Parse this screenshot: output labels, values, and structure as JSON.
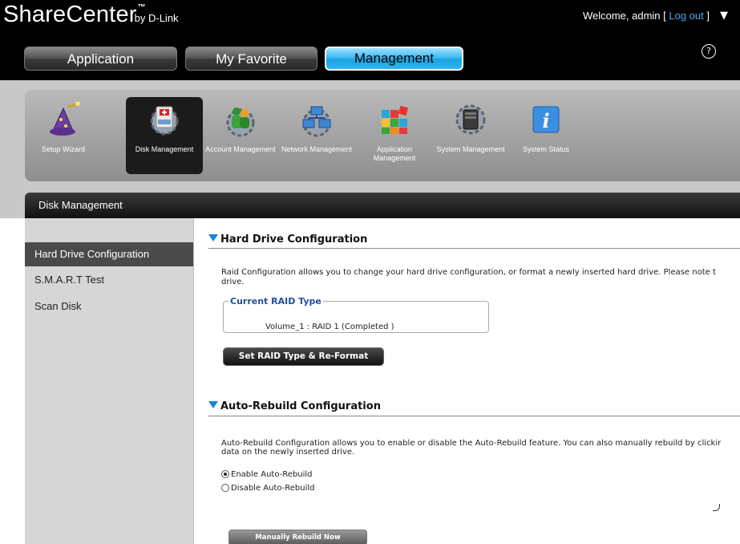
{
  "header": {
    "logo": {
      "name": "ShareCenter",
      "tm": "™",
      "by": "by D-Link"
    },
    "welcome_prefix": "Welcome, admin [ ",
    "logout": "Log out",
    "welcome_suffix": " ]",
    "caret": "▼",
    "help": "?"
  },
  "nav": {
    "tabs": [
      {
        "label": "Application"
      },
      {
        "label": "My Favorite"
      },
      {
        "label": "Management"
      }
    ],
    "active": "Management"
  },
  "toolbar": {
    "items": [
      {
        "label": "Setup Wizard",
        "icon": "wizard-icon"
      },
      {
        "label": "Disk Management",
        "icon": "disk-management-icon"
      },
      {
        "label": "Account Management",
        "icon": "account-management-icon"
      },
      {
        "label": "Network Management",
        "icon": "network-management-icon"
      },
      {
        "label": "Application Management",
        "icon": "application-management-icon"
      },
      {
        "label": "System Management",
        "icon": "system-management-icon"
      },
      {
        "label": "System Status",
        "icon": "system-status-icon"
      }
    ],
    "active": "Disk Management"
  },
  "section": {
    "title": "Disk Management"
  },
  "sidebar": {
    "items": [
      {
        "label": "Hard Drive Configuration"
      },
      {
        "label": "S.M.A.R.T Test"
      },
      {
        "label": "Scan Disk"
      }
    ],
    "active": "Hard Drive Configuration"
  },
  "hard_drive": {
    "title": "Hard Drive Configuration",
    "desc_line1": "Raid Configuration allows you to change your hard drive configuration, or format a newly inserted hard drive. Please note t",
    "desc_line2": "drive.",
    "raid_legend": "Current RAID Type",
    "raid_value": "Volume_1 : RAID 1 (Completed )",
    "set_button": "Set RAID Type & Re-Format"
  },
  "auto_rebuild": {
    "title": "Auto-Rebuild Configuration",
    "desc_line1": "Auto-Rebuild Configuration allows you to enable or disable the Auto-Rebuild feature. You can also manually rebuild by clickir",
    "desc_line2": "data on the newly inserted drive.",
    "options": [
      {
        "label": "Enable Auto-Rebuild",
        "selected": true
      },
      {
        "label": "Disable Auto-Rebuild",
        "selected": false
      }
    ],
    "rebuild_button": "Manually Rebuild Now"
  },
  "colors": {
    "accent": "#1aa2e0",
    "heading_triangle": "#1a86d8",
    "legend_blue": "#264d9a",
    "link": "#4aa8e8"
  }
}
